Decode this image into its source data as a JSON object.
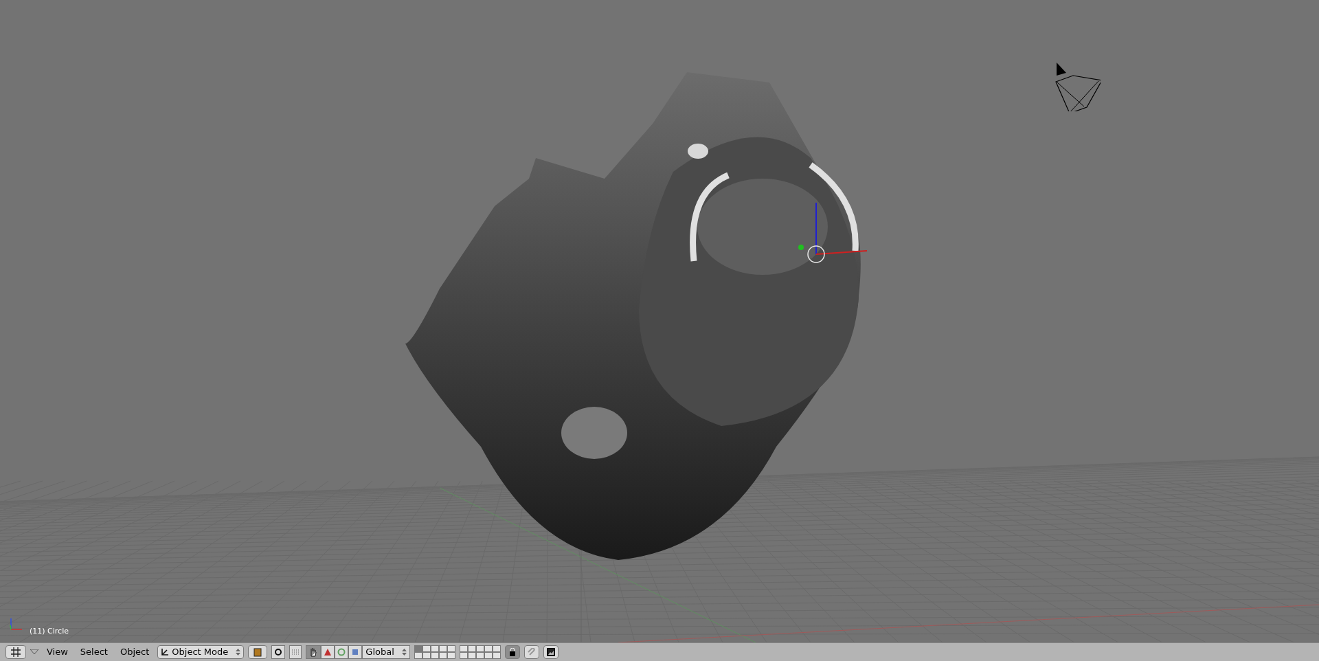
{
  "viewport": {
    "status_text": "(11) Circle"
  },
  "header": {
    "menus": [
      "View",
      "Select",
      "Object"
    ],
    "mode": "Object Mode",
    "orientation": "Global",
    "manipulator_on": true,
    "lock_layers": true,
    "layers": [
      {
        "selected": true
      },
      {
        "selected": false
      },
      {
        "selected": false
      },
      {
        "selected": false
      },
      {
        "selected": false
      },
      {
        "selected": false
      },
      {
        "selected": false
      },
      {
        "selected": false
      },
      {
        "selected": false
      },
      {
        "selected": false
      },
      {
        "selected": false
      },
      {
        "selected": false
      },
      {
        "selected": false
      },
      {
        "selected": false
      },
      {
        "selected": false
      },
      {
        "selected": false
      },
      {
        "selected": false
      },
      {
        "selected": false
      },
      {
        "selected": false
      },
      {
        "selected": false
      }
    ]
  }
}
